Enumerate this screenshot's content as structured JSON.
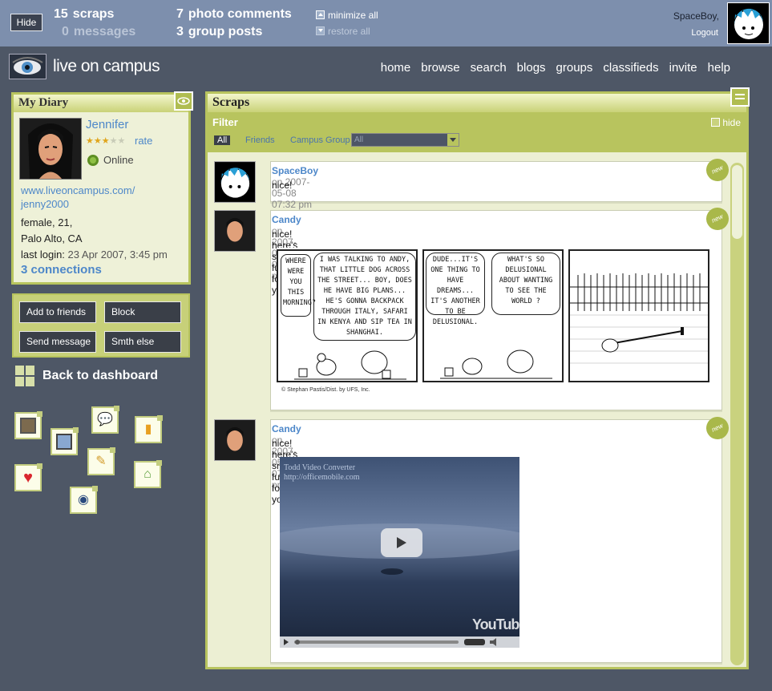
{
  "topbar": {
    "hide_label": "Hide",
    "stats": [
      {
        "num": "15",
        "label": "scraps"
      },
      {
        "num": "0",
        "label": "messages"
      },
      {
        "num": "7",
        "label": "photo comments"
      },
      {
        "num": "3",
        "label": "group posts"
      }
    ],
    "minimize_all": "minimize all",
    "restore_all": "restore all",
    "user": "SpaceBoy,",
    "logout": "Logout"
  },
  "header": {
    "logo_text": "live on campus",
    "nav": [
      "home",
      "browse",
      "search",
      "blogs",
      "groups",
      "classifieds",
      "invite",
      "help"
    ]
  },
  "diary": {
    "title": "My Diary",
    "name": "Jennifer",
    "rating": 3,
    "rating_max": 5,
    "rate_label": "rate",
    "status": "Online",
    "url_line1": "www.liveoncampus.com/",
    "url_line2": "jenny2000",
    "info_line1": "female, 21,",
    "info_line2": "Palo Alto, CA",
    "last_login_label": "last login:",
    "last_login_value": "23 Apr 2007, 3:45 pm",
    "connections": "3 connections"
  },
  "actions": [
    "Add to friends",
    "Block",
    "Send message",
    "Smth else"
  ],
  "back_to_dashboard": "Back to dashboard",
  "app_icons": [
    "photo-icon",
    "chat-icon",
    "folder-icon",
    "picture-icon",
    "notes-icon",
    "heart-icon",
    "house-icon",
    "video-icon"
  ],
  "scraps": {
    "title": "Scraps",
    "filter_label": "Filter",
    "hide_label": "hide",
    "tabs": [
      "All",
      "Friends",
      "Campus Group"
    ],
    "select_value": "All",
    "new_label": "new",
    "posts": [
      {
        "author": "SpaceBoy",
        "meta": "on 2007-05-08 07:32 pm",
        "text": "nice!"
      },
      {
        "author": "Candy",
        "meta": "on 2007-05-08 07:32 pm",
        "text": "nice! here's smth funny for you"
      },
      {
        "author": "Candy",
        "meta": "on 2007-05-08 07:32 pm",
        "text": "nice! here's smth funny for you"
      }
    ],
    "comic": {
      "bubble1": "WHERE WERE YOU THIS MORNING?",
      "bubble2": "I WAS TALKING TO ANDY, THAT LITTLE DOG ACROSS THE STREET... BOY, DOES HE HAVE BIG PLANS... HE'S GONNA BACKPACK THROUGH ITALY, SAFARI IN KENYA AND SIP TEA IN SHANGHAI.",
      "bubble3": "DUDE...IT'S ONE THING TO HAVE DREAMS... IT'S ANOTHER TO BE DELUSIONAL.",
      "bubble4": "WHAT'S SO DELUSIONAL ABOUT WANTING TO SEE THE WORLD ?",
      "credit": "© Stephan Pastis/Dist. by UFS, Inc."
    },
    "video": {
      "title_line1": "Todd Video Converter",
      "title_line2": "http://officemobile.com",
      "brand": "YouTube"
    }
  }
}
